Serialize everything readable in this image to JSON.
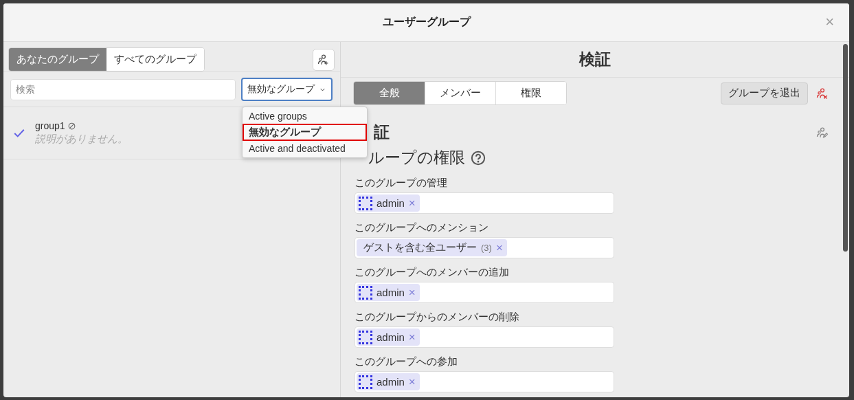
{
  "dialog": {
    "title": "ユーザーグループ",
    "close": "×"
  },
  "left_panel": {
    "tabs": [
      {
        "label": "あなたのグループ",
        "selected": true
      },
      {
        "label": "すべてのグループ",
        "selected": false
      }
    ],
    "search": {
      "placeholder": "検索"
    },
    "filter": {
      "value": "無効なグループ",
      "expanded": true,
      "options": [
        {
          "label": "Active groups",
          "selected": false
        },
        {
          "label": "無効なグループ",
          "selected": true
        },
        {
          "label": "Active and deactivated",
          "selected": false
        }
      ]
    },
    "groups": [
      {
        "name": "group1",
        "deactivated": true,
        "description": "説明がありません。",
        "checked": true
      }
    ]
  },
  "right_panel": {
    "title": "検証",
    "tabs": [
      {
        "label": "全般",
        "selected": true
      },
      {
        "label": "メンバー",
        "selected": false
      },
      {
        "label": "権限",
        "selected": false
      }
    ],
    "leave_button": "グループを退出",
    "heading": "証",
    "section_title": "ループの権限",
    "permissions": [
      {
        "label": "このグループの管理",
        "pills": [
          {
            "kind": "user",
            "name": "admin",
            "remove": "×"
          }
        ]
      },
      {
        "label": "このグループへのメンション",
        "pills": [
          {
            "kind": "group",
            "name": "ゲストを含む全ユーザー",
            "count": "(3)",
            "remove": "×"
          }
        ]
      },
      {
        "label": "このグループへのメンバーの追加",
        "pills": [
          {
            "kind": "user",
            "name": "admin",
            "remove": "×"
          }
        ]
      },
      {
        "label": "このグループからのメンバーの削除",
        "pills": [
          {
            "kind": "user",
            "name": "admin",
            "remove": "×"
          }
        ]
      },
      {
        "label": "このグループへの参加",
        "pills": [
          {
            "kind": "user",
            "name": "admin",
            "remove": "×"
          }
        ]
      }
    ]
  }
}
